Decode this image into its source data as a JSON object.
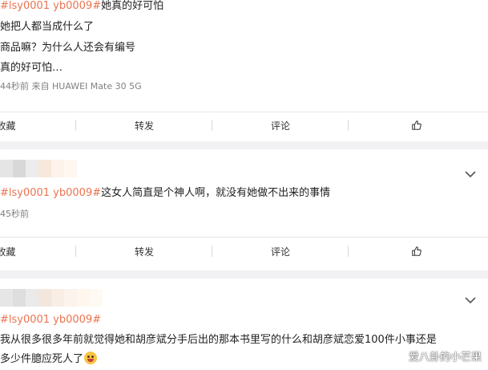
{
  "post": {
    "hashtag": "#lsy0001 yb0009#",
    "title_rest": "她真的好可怕",
    "lines": [
      "她把人都当成什么了",
      "商品嘛？为什么人还会有编号",
      "真的好可怕…"
    ],
    "meta": "44秒前  来自 HUAWEI Mate 30 5G",
    "actions": {
      "favorite": "收藏",
      "forward": "转发",
      "comment": "评论"
    }
  },
  "repost1": {
    "hashtag": "#lsy0001 yb0009#",
    "text": "这女人简直是个神人啊，就没有她做不出来的事情",
    "meta": "45秒前",
    "actions": {
      "favorite": "收藏",
      "forward": "转发",
      "comment": "评论"
    }
  },
  "repost2": {
    "hashtag": "#lsy0001 yb0009#",
    "line1": "我从很多很多年前就觉得她和胡彦斌分手后出的那本书里写的什么和胡彦斌恋爱100件小事还是",
    "line2": "多少件臆应死人了"
  },
  "watermark": "爱八卦的小芒果",
  "colors": {
    "accent": "#eb7350",
    "background": "#f2f2f5",
    "card": "#ffffff"
  },
  "icons": {
    "like": "thumbs-up-icon",
    "expand": "chevron-down-icon",
    "emoji": "laughing-crying-emoji-icon"
  }
}
